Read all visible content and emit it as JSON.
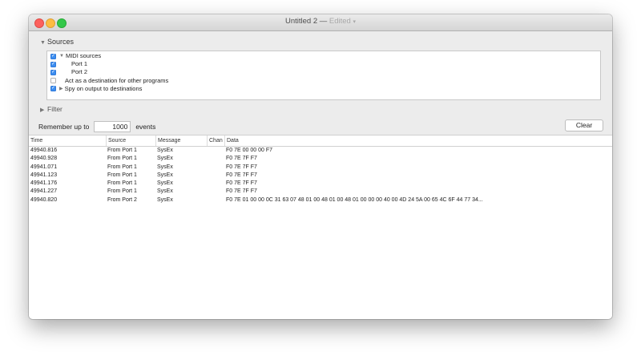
{
  "window": {
    "title": "Untitled 2",
    "title_sep": " — ",
    "edited": "Edited",
    "caret": "▾"
  },
  "sources": {
    "header": "Sources",
    "items": [
      {
        "label": "MIDI sources",
        "checked": true,
        "expand": "▼",
        "indent": 0
      },
      {
        "label": "Port 1",
        "checked": true,
        "indent": 1
      },
      {
        "label": "Port 2",
        "checked": true,
        "indent": 1
      },
      {
        "label": "Act as a destination for other programs",
        "checked": false,
        "indent": 0
      },
      {
        "label": "Spy on output to destinations",
        "checked": true,
        "expand": "▶",
        "indent": 0
      }
    ]
  },
  "filter": {
    "header": "Filter"
  },
  "remember": {
    "prefix": "Remember up to",
    "value": "1000",
    "suffix": "events"
  },
  "toolbar": {
    "clear_label": "Clear"
  },
  "table": {
    "columns": [
      "Time",
      "Source",
      "Message",
      "Chan",
      "Data"
    ],
    "rows": [
      [
        "49940.816",
        "From Port 1",
        "SysEx",
        "",
        "F0 7E 00 00 00 F7"
      ],
      [
        "49940.928",
        "From Port 1",
        "SysEx",
        "",
        "F0 7E 7F F7"
      ],
      [
        "49941.071",
        "From Port 1",
        "SysEx",
        "",
        "F0 7E 7F F7"
      ],
      [
        "49941.123",
        "From Port 1",
        "SysEx",
        "",
        "F0 7E 7F F7"
      ],
      [
        "49941.176",
        "From Port 1",
        "SysEx",
        "",
        "F0 7E 7F F7"
      ],
      [
        "49941.227",
        "From Port 1",
        "SysEx",
        "",
        "F0 7E 7F F7"
      ],
      [
        "49940.820",
        "From Port 2",
        "SysEx",
        "",
        "F0 7E 01 00 00 0C 31 63 07 48 01 00 48 01 00 48 01 00 00 00 40 00 4D 24 5A 00 65 4C 6F 44 77 34..."
      ]
    ]
  }
}
